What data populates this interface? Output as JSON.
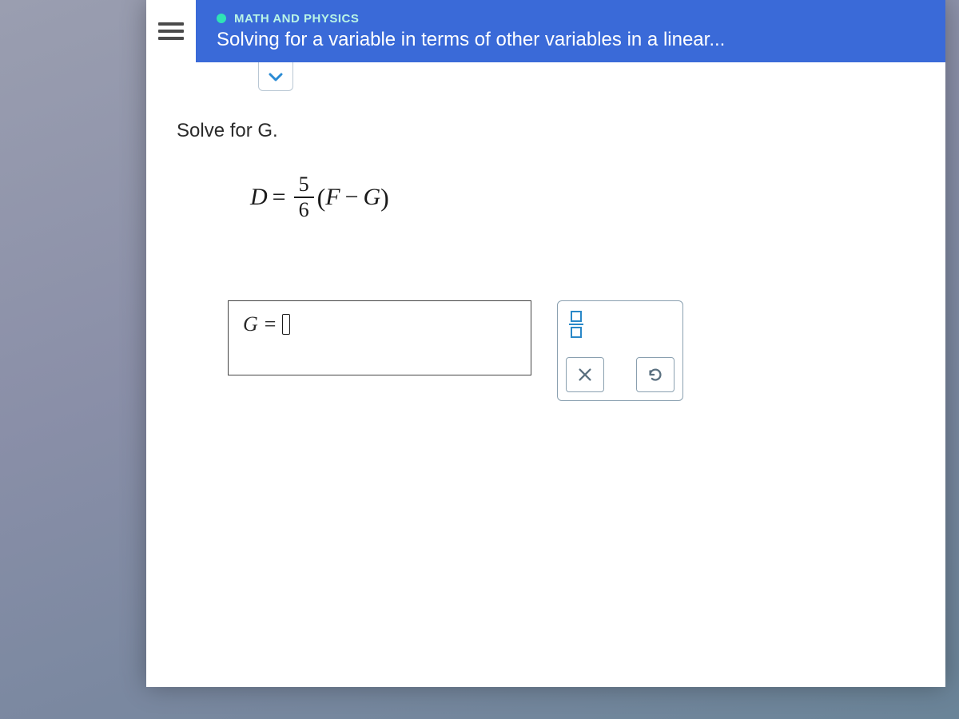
{
  "header": {
    "category": "MATH AND PHYSICS",
    "title": "Solving for a variable in terms of other variables in a linear..."
  },
  "problem": {
    "prompt": "Solve for G.",
    "equation": {
      "lhs": "D",
      "frac_num": "5",
      "frac_den": "6",
      "paren_left": "(",
      "term1": "F",
      "minus": "−",
      "term2": "G",
      "paren_right": ")"
    },
    "eq_sign": "="
  },
  "answer": {
    "label": "G",
    "eq": "="
  },
  "tools": {
    "fraction": "fraction",
    "clear": "×",
    "reset": "↺"
  }
}
